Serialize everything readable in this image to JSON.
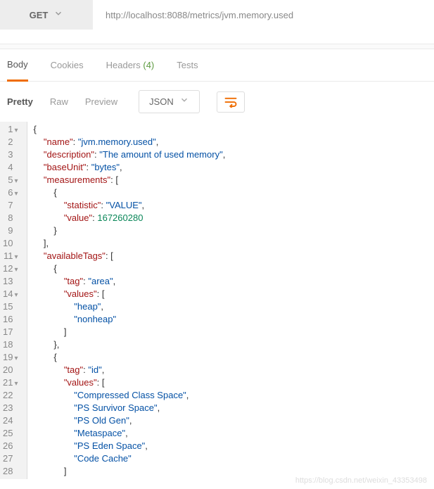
{
  "request": {
    "method": "GET",
    "url": "http://localhost:8088/metrics/jvm.memory.used"
  },
  "tabs": {
    "body": "Body",
    "cookies": "Cookies",
    "headers": "Headers",
    "headers_count": "(4)",
    "tests": "Tests"
  },
  "toolbar": {
    "pretty": "Pretty",
    "raw": "Raw",
    "preview": "Preview",
    "format": "JSON"
  },
  "watermark": "https://blog.csdn.net/weixin_43353498",
  "response": {
    "name": "jvm.memory.used",
    "description": "The amount of used memory",
    "baseUnit": "bytes",
    "measurements": [
      {
        "statistic": "VALUE",
        "value": 167260280
      }
    ],
    "availableTags": [
      {
        "tag": "area",
        "values": [
          "heap",
          "nonheap"
        ]
      },
      {
        "tag": "id",
        "values": [
          "Compressed Class Space",
          "PS Survivor Space",
          "PS Old Gen",
          "Metaspace",
          "PS Eden Space",
          "Code Cache"
        ]
      }
    ]
  },
  "gutter": {
    "lines": [
      "1",
      "2",
      "3",
      "4",
      "5",
      "6",
      "7",
      "8",
      "9",
      "10",
      "11",
      "12",
      "13",
      "14",
      "15",
      "16",
      "17",
      "18",
      "19",
      "20",
      "21",
      "22",
      "23",
      "24",
      "25",
      "26",
      "27",
      "28"
    ],
    "folds": [
      true,
      false,
      false,
      false,
      true,
      true,
      false,
      false,
      false,
      false,
      true,
      true,
      false,
      true,
      false,
      false,
      false,
      false,
      true,
      false,
      true,
      false,
      false,
      false,
      false,
      false,
      false,
      false
    ]
  }
}
